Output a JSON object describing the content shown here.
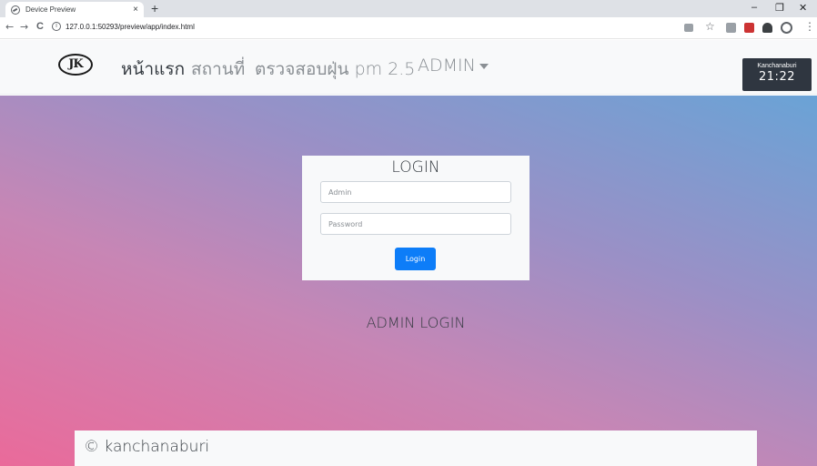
{
  "browser": {
    "tab_title": "Device Preview",
    "tab_close": "×",
    "new_tab": "+",
    "url": "127.0.0.1:50293/preview/app/index.html",
    "minimize": "–",
    "maximize": "❐",
    "close": "✕",
    "back": "←",
    "forward": "→",
    "reload": "C",
    "info": "i",
    "star": "☆",
    "menu": "⋮",
    "colors": {
      "pdf_ext": "#cc3333",
      "grey_ext": "#9aa0a6"
    }
  },
  "navbar": {
    "logo_text": "JK",
    "items": [
      {
        "label": "หน้าแรก"
      },
      {
        "label": "สถานที่"
      },
      {
        "label": "ตรวจสอบฝุ่น pm 2.5"
      },
      {
        "label": "ADMIN"
      }
    ],
    "clock": {
      "city": "Kanchanaburi",
      "time": "21:22"
    }
  },
  "login": {
    "title": "LOGIN",
    "username_placeholder": "Admin",
    "password_placeholder": "Password",
    "button_label": "Login",
    "button_color": "#0d7df8"
  },
  "main": {
    "heading": "ADMIN LOGIN"
  },
  "footer": {
    "text": "© kanchanaburi"
  }
}
